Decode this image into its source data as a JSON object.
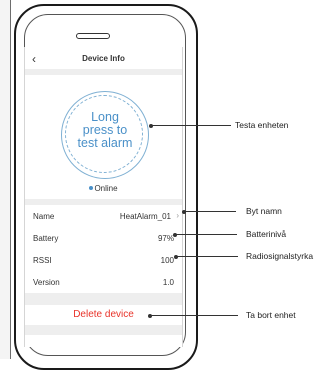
{
  "nav": {
    "title": "Device Info",
    "back_icon": "chevron-left-icon"
  },
  "test_button": {
    "label_line1": "Long",
    "label_line2": "press to",
    "label_line3": "test alarm"
  },
  "status": "Online",
  "rows": [
    {
      "key": "Name",
      "value": "HeatAlarm_01"
    },
    {
      "key": "Battery",
      "value": "97%"
    },
    {
      "key": "RSSI",
      "value": "100"
    },
    {
      "key": "Version",
      "value": "1.0"
    }
  ],
  "delete_label": "Delete device",
  "annotations": {
    "test": "Testa enheten",
    "rename": "Byt namn",
    "battery": "Batterinivå",
    "signal": "Radiosignalstyrka",
    "delete": "Ta bort enhet"
  },
  "colors": {
    "accent": "#4a90c8",
    "danger": "#e8332a"
  }
}
